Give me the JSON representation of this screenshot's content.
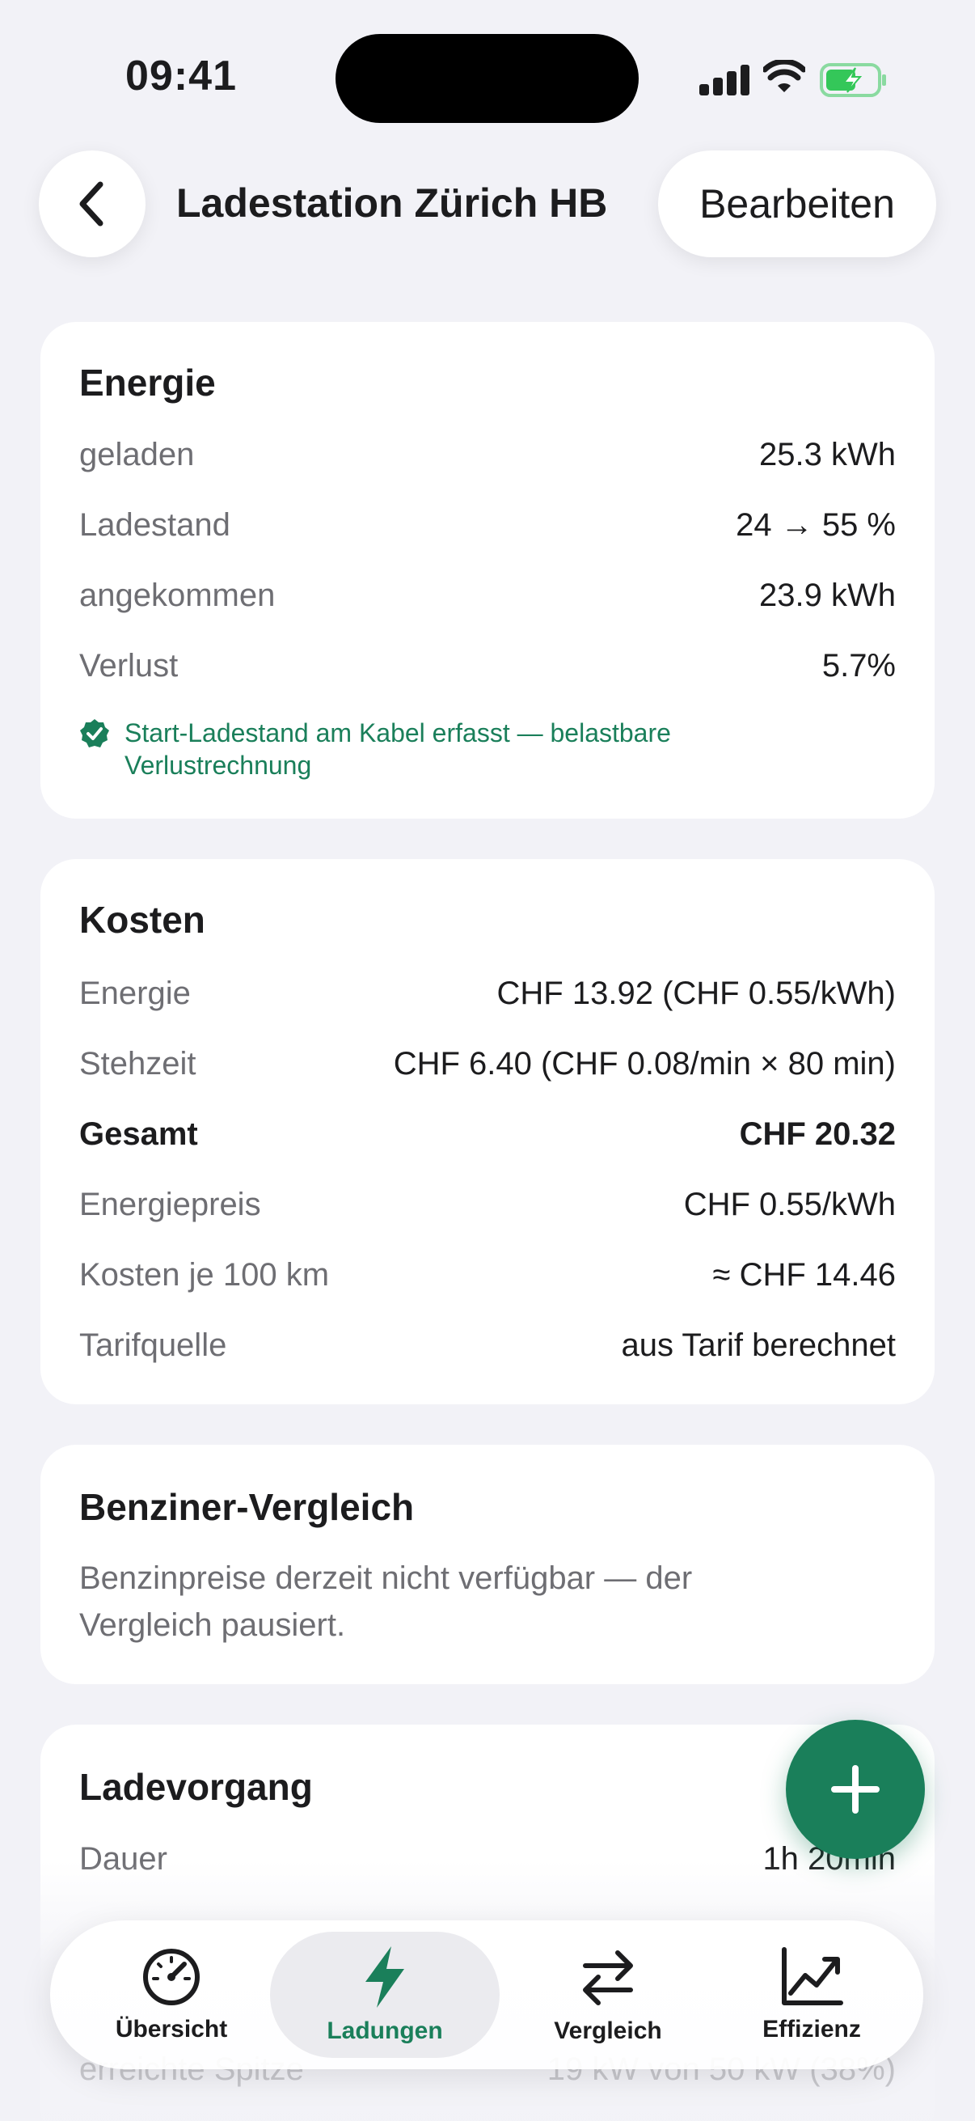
{
  "status_bar": {
    "time": "09:41"
  },
  "nav": {
    "title": "Ladestation Zürich HB",
    "edit_label": "Bearbeiten"
  },
  "energy": {
    "title": "Energie",
    "rows": [
      {
        "label": "geladen",
        "value": "25.3 kWh"
      },
      {
        "label": "Ladestand",
        "value": "24 → 55 %"
      },
      {
        "label": "angekommen",
        "value": "23.9 kWh"
      },
      {
        "label": "Verlust",
        "value": "5.7%"
      }
    ],
    "verified_line1": "Start-Ladestand am Kabel erfasst — belastbare",
    "verified_line2": "Verlustrechnung"
  },
  "costs": {
    "title": "Kosten",
    "rows": [
      {
        "label": "Energie",
        "value": "CHF 13.92 (CHF 0.55/kWh)"
      },
      {
        "label": "Stehzeit",
        "value": "CHF 6.40 (CHF 0.08/min × 80 min)"
      },
      {
        "label": "Gesamt",
        "value": "CHF 20.32"
      },
      {
        "label": "Energiepreis",
        "value": "CHF 0.55/kWh"
      },
      {
        "label": "Kosten je 100 km",
        "value": "≈ CHF 14.46"
      },
      {
        "label": "Tarifquelle",
        "value": "aus Tarif berechnet"
      }
    ]
  },
  "fuel_compare": {
    "title": "Benziner-Vergleich",
    "text_line1": "Benzinpreise derzeit nicht verfügbar — der",
    "text_line2": "Vergleich pausiert."
  },
  "session": {
    "title": "Ladevorgang",
    "rows": [
      {
        "label": "Dauer",
        "value": "1h 20min"
      }
    ],
    "faded_row": {
      "label": "erreichte Spitze",
      "value": "19 kW von 50 kW (38%)"
    }
  },
  "tabbar": {
    "tabs": [
      {
        "label": "Übersicht",
        "icon": "speedometer-icon"
      },
      {
        "label": "Ladungen",
        "icon": "bolt-icon"
      },
      {
        "label": "Vergleich",
        "icon": "arrows-swap-icon"
      },
      {
        "label": "Effizienz",
        "icon": "chart-trend-icon"
      }
    ],
    "active_index": 1
  },
  "colors": {
    "accent": "#1a7f5a",
    "background": "#f2f2f7",
    "secondary_text": "#6e6e73"
  }
}
